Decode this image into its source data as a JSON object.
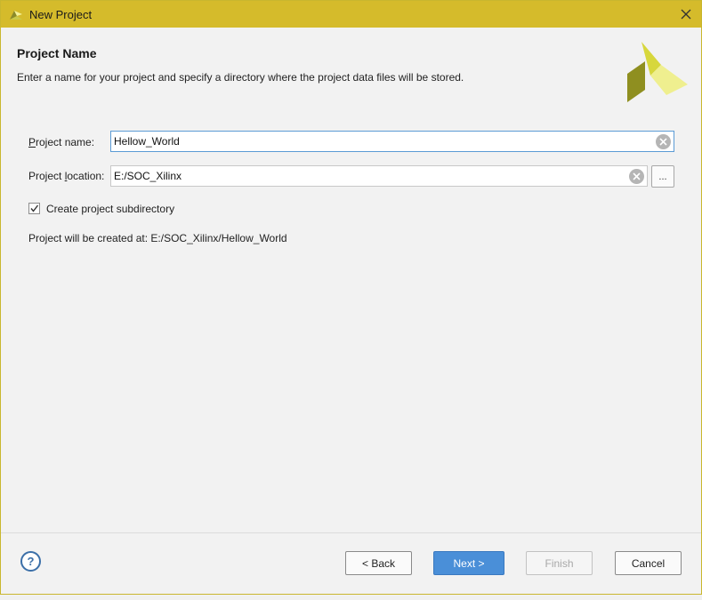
{
  "window": {
    "title": "New Project"
  },
  "header": {
    "title": "Project Name",
    "description": "Enter a name for your project and specify a directory where the project data files will be stored."
  },
  "form": {
    "name_label_underlined": "P",
    "name_label_rest": "roject name:",
    "name_value": "Hellow_World",
    "location_label_start": "Project ",
    "location_label_underlined": "l",
    "location_label_rest": "ocation:",
    "location_value": "E:/SOC_Xilinx",
    "browse_label": "...",
    "subdirectory_label": "Create project subdirectory",
    "subdirectory_checked": true,
    "created_at_text": "Project will be created at: E:/SOC_Xilinx/Hellow_World"
  },
  "footer": {
    "help_label": "?",
    "back_label": "< Back",
    "next_label": "Next >",
    "finish_label": "Finish",
    "cancel_label": "Cancel"
  },
  "colors": {
    "titlebar": "#d5bb2b",
    "primary_button": "#4a8fd8",
    "focus_border": "#5b9bd5"
  },
  "icons": {
    "app": "vivado-logo-icon",
    "close": "close-icon",
    "clear": "clear-icon",
    "check": "checkmark-icon",
    "help": "help-icon"
  }
}
